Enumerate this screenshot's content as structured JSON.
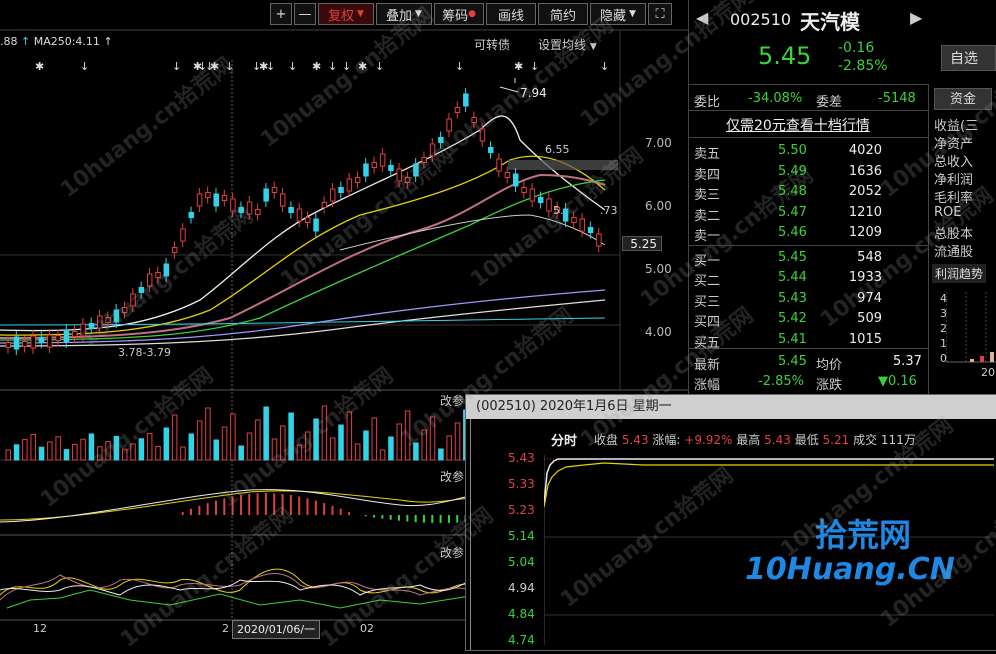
{
  "toolbar": {
    "plus": "+",
    "minus": "—",
    "fuquan": "复权",
    "diejia": "叠加",
    "chouma": "筹码",
    "huaxian": "画线",
    "jianyue": "简约",
    "yincang": "隐藏"
  },
  "main_chart": {
    "ma_legend": "MA250:4.11",
    "ma_legend_prefix": ".88",
    "kezhuanzhai": "可转债",
    "set_ma": "设置均线",
    "price_labels": [
      "7.00",
      "6.00",
      "5.00",
      "4.00"
    ],
    "current_price_tag": "5.25",
    "high_annotation": "7.94",
    "low_annotation": "3.78-3.79",
    "mid_annotation": "6.55",
    "right_annotation": ".73",
    "left_annotation": "5.",
    "date_tag": "2020/01/06/一",
    "bottom_ticks": [
      "12",
      "2",
      "02"
    ],
    "panel_labels": [
      "改参",
      "改参",
      "改参"
    ]
  },
  "quote": {
    "code": "002510",
    "name": "天汽模",
    "price": "5.45",
    "change": "-0.16",
    "change_pct": "-2.85%",
    "zixuan": "自选",
    "weibi_label": "委比",
    "weibi": "-34.08%",
    "weicha_label": "委差",
    "weicha": "-5148",
    "ten_level_link": "仅需20元查看十档行情",
    "sells": [
      {
        "label": "卖五",
        "price": "5.50",
        "vol": "4020"
      },
      {
        "label": "卖四",
        "price": "5.49",
        "vol": "1636"
      },
      {
        "label": "卖三",
        "price": "5.48",
        "vol": "2052"
      },
      {
        "label": "卖二",
        "price": "5.47",
        "vol": "1210"
      },
      {
        "label": "卖一",
        "price": "5.46",
        "vol": "1209"
      }
    ],
    "buys": [
      {
        "label": "买一",
        "price": "5.45",
        "vol": "548"
      },
      {
        "label": "买二",
        "price": "5.44",
        "vol": "1933"
      },
      {
        "label": "买三",
        "price": "5.43",
        "vol": "974"
      },
      {
        "label": "买四",
        "price": "5.42",
        "vol": "509"
      },
      {
        "label": "买五",
        "price": "5.41",
        "vol": "1015"
      }
    ],
    "latest_label": "最新",
    "latest": "5.45",
    "avg_label": "均价",
    "avg": "5.37",
    "zf_label": "涨幅",
    "zf": "-2.85%",
    "zd_label": "涨跌",
    "zd": "▼0.16"
  },
  "fundamentals": {
    "tab": "资金",
    "items": [
      "收益(三",
      "净资产",
      "总收入",
      "净利润",
      "毛利率",
      "ROE",
      "总股本",
      "流通股"
    ],
    "trend_title": "利润趋势",
    "trend_axis": [
      "4",
      "3",
      "2",
      "1",
      "0"
    ],
    "trend_year": "20"
  },
  "popup": {
    "title": "(002510) 2020年1月6日 星期一",
    "fenshi": "分时",
    "shoupan_label": "收盘",
    "shoupan": "5.43",
    "zhangfu_label": "涨幅",
    "zhangfu": "+9.92%",
    "zuigao_label": "最高",
    "zuigao": "5.43",
    "zuidi_label": "最低",
    "zuidi": "5.21",
    "chengjiao_label": "成交",
    "chengjiao": "111万",
    "y_labels": [
      "5.43",
      "5.33",
      "5.23",
      "5.14",
      "5.04",
      "4.94",
      "4.84",
      "4.74"
    ]
  },
  "logo": {
    "cn": "拾荒网",
    "en": "10Huang.CN"
  },
  "watermark": "10huang.cn拾荒网",
  "colors": {
    "up": "#e04040",
    "down": "#2fd4e8",
    "green": "#3ad23a",
    "yellow": "#e6d200",
    "logo": "#1e88e5"
  }
}
